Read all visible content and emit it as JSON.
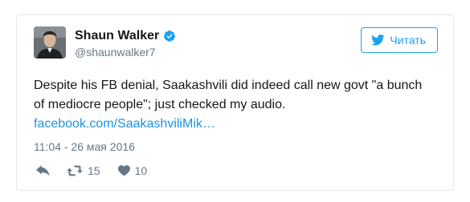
{
  "tweet": {
    "author": {
      "display_name": "Shaun Walker",
      "handle": "@shaunwalker7",
      "verified": true,
      "avatar_icon": "person-photo"
    },
    "follow_button": {
      "label": "Читать",
      "icon": "bird-icon",
      "color": "#1da1f2"
    },
    "text": "Despite his FB denial, Saakashvili did indeed call new govt \"a bunch of mediocre people\"; just checked my audio.",
    "link_text": "facebook.com/SaakashviliMik…",
    "link_color": "#1b95e0",
    "timestamp": "11:04 - 26 мая 2016",
    "actions": {
      "reply_icon": "reply-icon",
      "retweet_icon": "retweet-icon",
      "retweet_count": "15",
      "like_icon": "heart-icon",
      "like_count": "10"
    }
  }
}
